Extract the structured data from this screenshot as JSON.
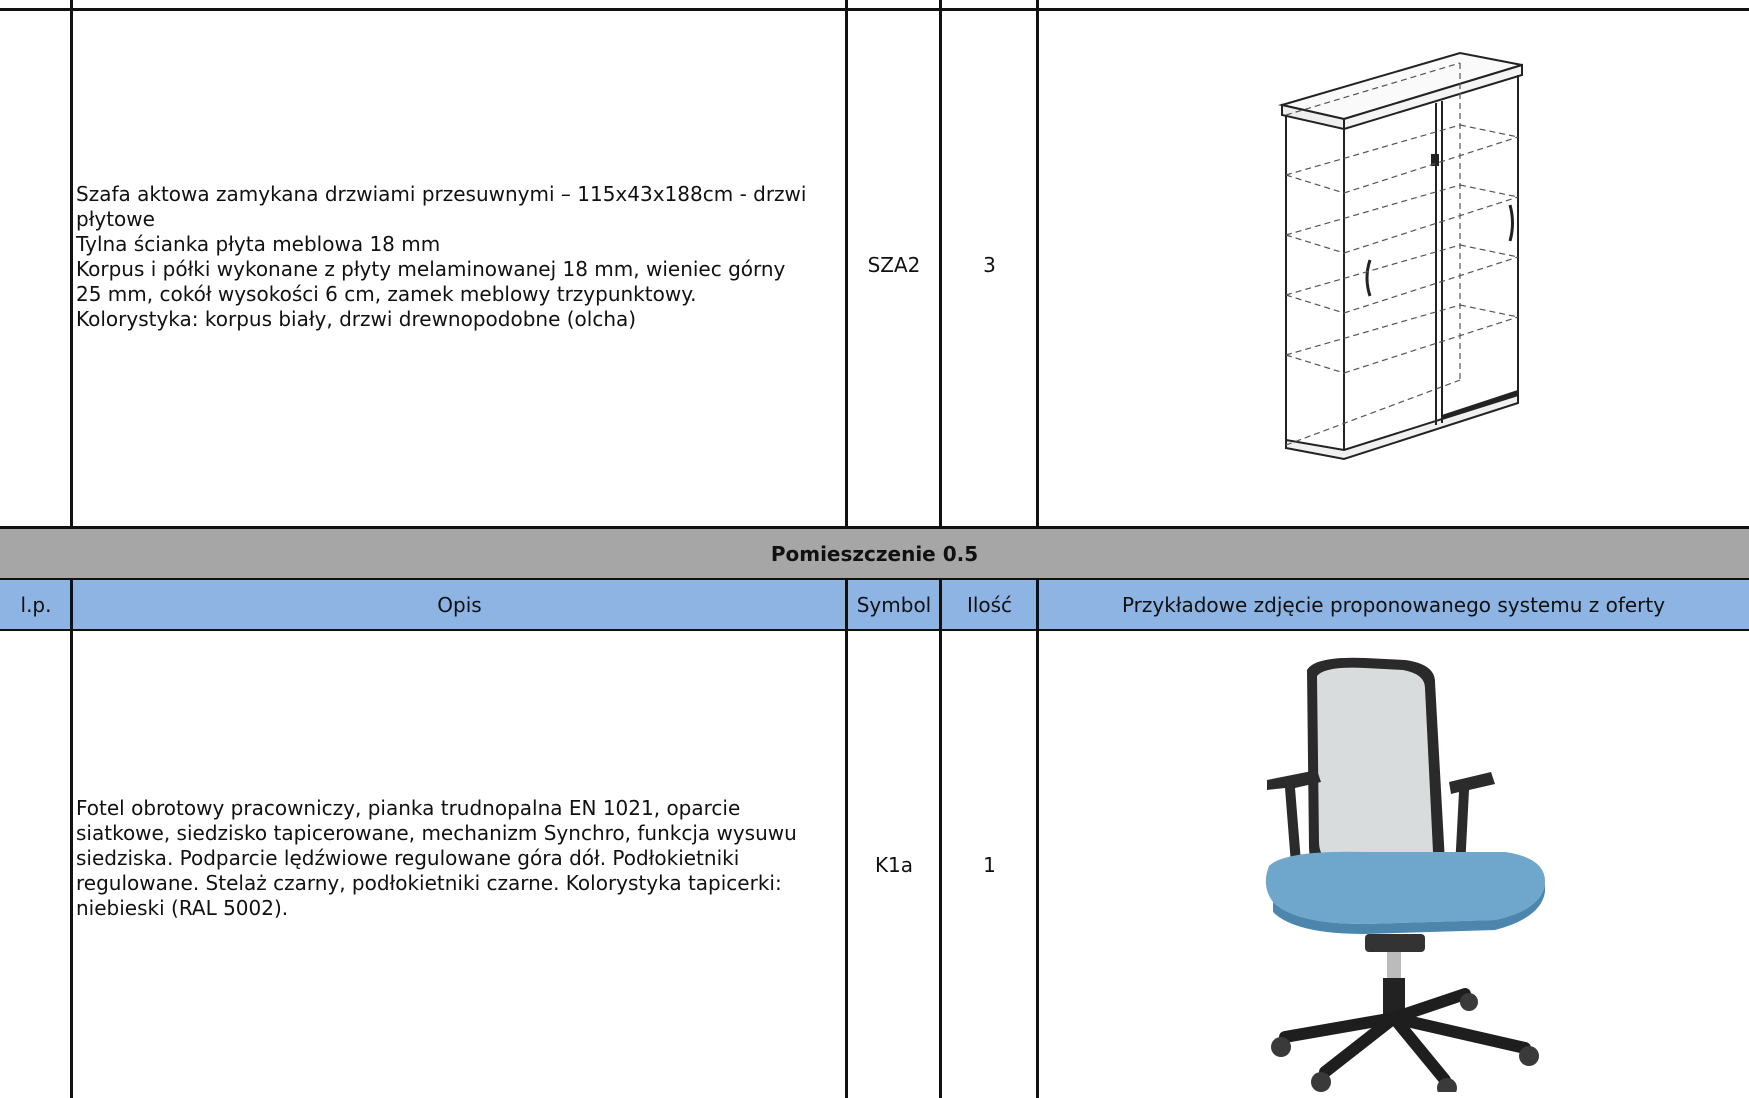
{
  "row1": {
    "description": "Szafa aktowa zamykana drzwiami przesuwnymi – 115x43x188cm - drzwi\npłytowe\nTylna ścianka płyta meblowa 18 mm\nKorpus i półki wykonane z płyty melaminowanej 18 mm, wieniec górny\n25 mm, cokół wysokości 6 cm, zamek meblowy trzypunktowy.\nKolorystyka: korpus biały, drzwi drewnopodobne (olcha)",
    "symbol": "SZA2",
    "quantity": "3",
    "image_icon": "sliding-door-cabinet-image"
  },
  "section": {
    "title": "Pomieszczenie 0.5"
  },
  "header": {
    "lp": "l.p.",
    "opis": "Opis",
    "symbol": "Symbol",
    "ilosc": "Ilość",
    "photo": "Przykładowe zdjęcie proponowanego systemu z oferty"
  },
  "row2": {
    "description": "Fotel obrotowy pracowniczy, pianka trudnopalna EN 1021, oparcie\nsiatkowe, siedzisko tapicerowane, mechanizm Synchro, funkcja wysuwu\nsiedziska. Podparcie lędźwiowe regulowane góra dół. Podłokietniki\nregulowane.  Stelaż czarny, podłokietniki czarne. Kolorystyka tapicerki:\nniebieski (RAL 5002).",
    "symbol": "K1a",
    "quantity": "1",
    "image_icon": "office-chair-image"
  },
  "colors": {
    "section_bar": "#a6a6a6",
    "header_bar": "#8db4e2",
    "seat_blue": "#6fa7cc"
  }
}
